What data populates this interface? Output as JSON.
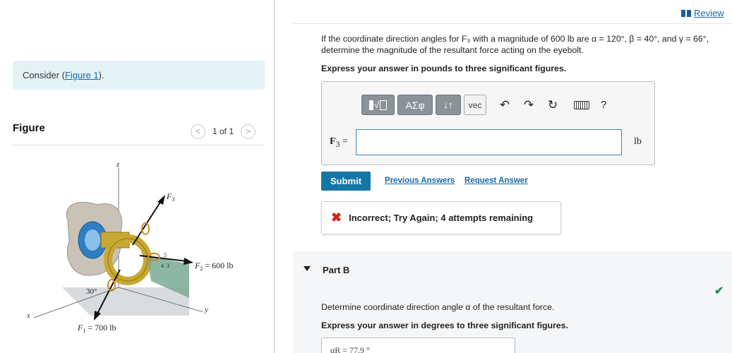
{
  "left": {
    "consider_prefix": "Consider (",
    "consider_link": "Figure 1",
    "consider_suffix": ").",
    "figure_title": "Figure",
    "pager_text": "1 of 1",
    "figure_labels": {
      "z": "z",
      "y": "y",
      "x": "x",
      "f3": "F",
      "f3_sub": "3",
      "f2": "F",
      "f2_sub": "2",
      "f2_value": " = 600 lb",
      "f1": "F",
      "f1_sub": "1",
      "f1_value": " = 700 lb",
      "angle": "30°",
      "tri_5": "5",
      "tri_4": "4",
      "tri_3": "3"
    }
  },
  "header": {
    "review_label": "Review"
  },
  "question": {
    "text": "If the coordinate direction angles for F₃ with a magnitude of 600 lb are α = 120°, β = 40°, and γ = 66°, determine the magnitude of the resultant force acting on the eyebolt.",
    "instruction": "Express your answer in pounds to three significant figures."
  },
  "toolbar": {
    "greek": "ΑΣφ",
    "arrows": "↓↑",
    "vec": "vec",
    "undo": "↶",
    "redo": "↷",
    "reset": "↻",
    "help": "?"
  },
  "answer": {
    "label_var": "F",
    "label_sub": "3",
    "label_eq": " =",
    "value": "",
    "unit": "lb"
  },
  "actions": {
    "submit": "Submit",
    "previous_answers": "Previous Answers",
    "request_answer": "Request Answer"
  },
  "feedback": {
    "icon": "✖",
    "text": "Incorrect; Try Again; 4 attempts remaining"
  },
  "part_b": {
    "title": "Part B",
    "question": "Determine coordinate direction angle α of the resultant force.",
    "instruction": "Express your answer in degrees to three significant figures.",
    "answer_text": "αR =  77.9 °",
    "status_icon": "✔"
  }
}
